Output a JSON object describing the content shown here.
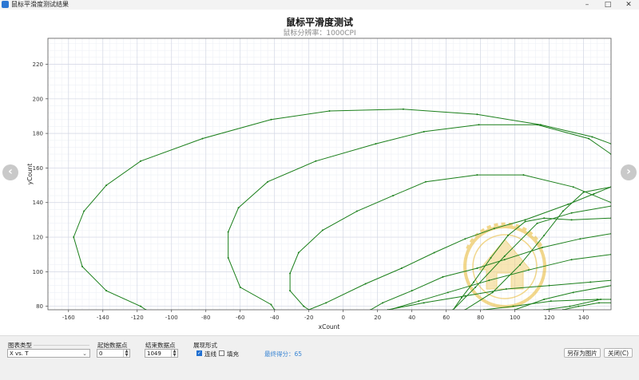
{
  "window": {
    "title": "鼠标平滑度测试结果",
    "buttons": [
      "–",
      "□",
      "✕"
    ]
  },
  "chart_data": {
    "type": "line",
    "title": "鼠标平滑度测试",
    "subtitle": "鼠标分辨率：1000CPI",
    "xlabel": "xCount",
    "ylabel": "yCount",
    "xlim": [
      -172,
      156
    ],
    "ylim": [
      78,
      235
    ],
    "xticks": [
      -160,
      -140,
      -120,
      -100,
      -80,
      -60,
      -40,
      -20,
      0,
      20,
      40,
      60,
      80,
      100,
      120,
      140
    ],
    "yticks": [
      80,
      100,
      120,
      140,
      160,
      180,
      200,
      220
    ],
    "grid": true,
    "line_color": "#1a7f1a",
    "series": [
      {
        "points": [
          [
            -115,
            78
          ],
          [
            -118,
            80
          ],
          [
            -138,
            89
          ],
          [
            -152,
            103
          ],
          [
            -157,
            120
          ],
          [
            -151,
            135
          ],
          [
            -138,
            150
          ],
          [
            -118,
            164
          ],
          [
            -82,
            177
          ],
          [
            -42,
            188
          ],
          [
            -8,
            193
          ],
          [
            35,
            194
          ],
          [
            78,
            191
          ],
          [
            115,
            185
          ],
          [
            145,
            178
          ],
          [
            156,
            174
          ]
        ]
      },
      {
        "points": [
          [
            -40,
            78
          ],
          [
            -42,
            81
          ],
          [
            -60,
            91
          ],
          [
            -67,
            108
          ],
          [
            -67,
            123
          ],
          [
            -61,
            137
          ],
          [
            -44,
            152
          ],
          [
            -16,
            164
          ],
          [
            19,
            174
          ],
          [
            47,
            181
          ],
          [
            79,
            185
          ],
          [
            113,
            185
          ],
          [
            143,
            177
          ],
          [
            156,
            168
          ]
        ]
      },
      {
        "points": [
          [
            -20,
            78
          ],
          [
            -23,
            80
          ],
          [
            -31,
            89
          ],
          [
            -31,
            99
          ],
          [
            -26,
            111
          ],
          [
            -12,
            124
          ],
          [
            8,
            135
          ],
          [
            29,
            144
          ],
          [
            48,
            152
          ],
          [
            78,
            156
          ],
          [
            105,
            156
          ],
          [
            134,
            149
          ],
          [
            156,
            140
          ]
        ]
      },
      {
        "points": [
          [
            -20,
            78
          ],
          [
            -10,
            82
          ],
          [
            13,
            93
          ],
          [
            34,
            102
          ],
          [
            53,
            111
          ],
          [
            71,
            119
          ],
          [
            88,
            125
          ],
          [
            106,
            130
          ],
          [
            131,
            139
          ],
          [
            146,
            145
          ],
          [
            156,
            149
          ]
        ]
      },
      {
        "points": [
          [
            16,
            78
          ],
          [
            23,
            82
          ],
          [
            40,
            89
          ],
          [
            58,
            97
          ],
          [
            78,
            102
          ],
          [
            94,
            107
          ],
          [
            116,
            114
          ],
          [
            138,
            119
          ],
          [
            156,
            122
          ]
        ]
      },
      {
        "points": [
          [
            27,
            78
          ],
          [
            44,
            83
          ],
          [
            61,
            88
          ],
          [
            85,
            95
          ],
          [
            108,
            101
          ],
          [
            133,
            107
          ],
          [
            156,
            110
          ]
        ]
      },
      {
        "points": [
          [
            26,
            78
          ],
          [
            47,
            82
          ],
          [
            71,
            86
          ],
          [
            95,
            90
          ],
          [
            120,
            92
          ],
          [
            144,
            94
          ],
          [
            156,
            95
          ]
        ]
      },
      {
        "points": [
          [
            82,
            78
          ],
          [
            99,
            80
          ],
          [
            121,
            83
          ],
          [
            148,
            84
          ],
          [
            156,
            84
          ]
        ]
      },
      {
        "points": [
          [
            71,
            78
          ],
          [
            87,
            88
          ],
          [
            103,
            104
          ],
          [
            117,
            121
          ],
          [
            128,
            135
          ],
          [
            140,
            146
          ],
          [
            156,
            149
          ]
        ]
      },
      {
        "points": [
          [
            64,
            78
          ],
          [
            77,
            91
          ],
          [
            94,
            109
          ],
          [
            113,
            128
          ],
          [
            133,
            134
          ],
          [
            156,
            138
          ]
        ]
      },
      {
        "points": [
          [
            100,
            78
          ],
          [
            117,
            84
          ],
          [
            134,
            88
          ],
          [
            156,
            92
          ]
        ]
      },
      {
        "points": [
          [
            117,
            78
          ],
          [
            132,
            80
          ],
          [
            150,
            84
          ],
          [
            156,
            84
          ]
        ]
      },
      {
        "points": [
          [
            64,
            78
          ],
          [
            69,
            85
          ],
          [
            76,
            94
          ],
          [
            86,
            108
          ],
          [
            96,
            121
          ],
          [
            106,
            129
          ],
          [
            117,
            131
          ],
          [
            133,
            130
          ],
          [
            156,
            131
          ]
        ]
      },
      {
        "points": [
          [
            128,
            78
          ],
          [
            137,
            80
          ],
          [
            149,
            82
          ],
          [
            156,
            82
          ]
        ]
      }
    ]
  },
  "controls": {
    "chart_type_label": "图表类型",
    "chart_type_value": "X vs. T",
    "start_label": "起始数据点",
    "start_value": "0",
    "end_label": "结束数据点",
    "end_value": "1049",
    "display_label": "展现形式",
    "line_label": "连线",
    "line_checked": true,
    "fill_label": "填充",
    "fill_checked": false,
    "score_text": "最终得分：65",
    "save_button": "另存为图片",
    "close_button": "关闭(C)"
  },
  "icons": {
    "prev": "chevron-left-icon",
    "next": "chevron-right-icon"
  }
}
